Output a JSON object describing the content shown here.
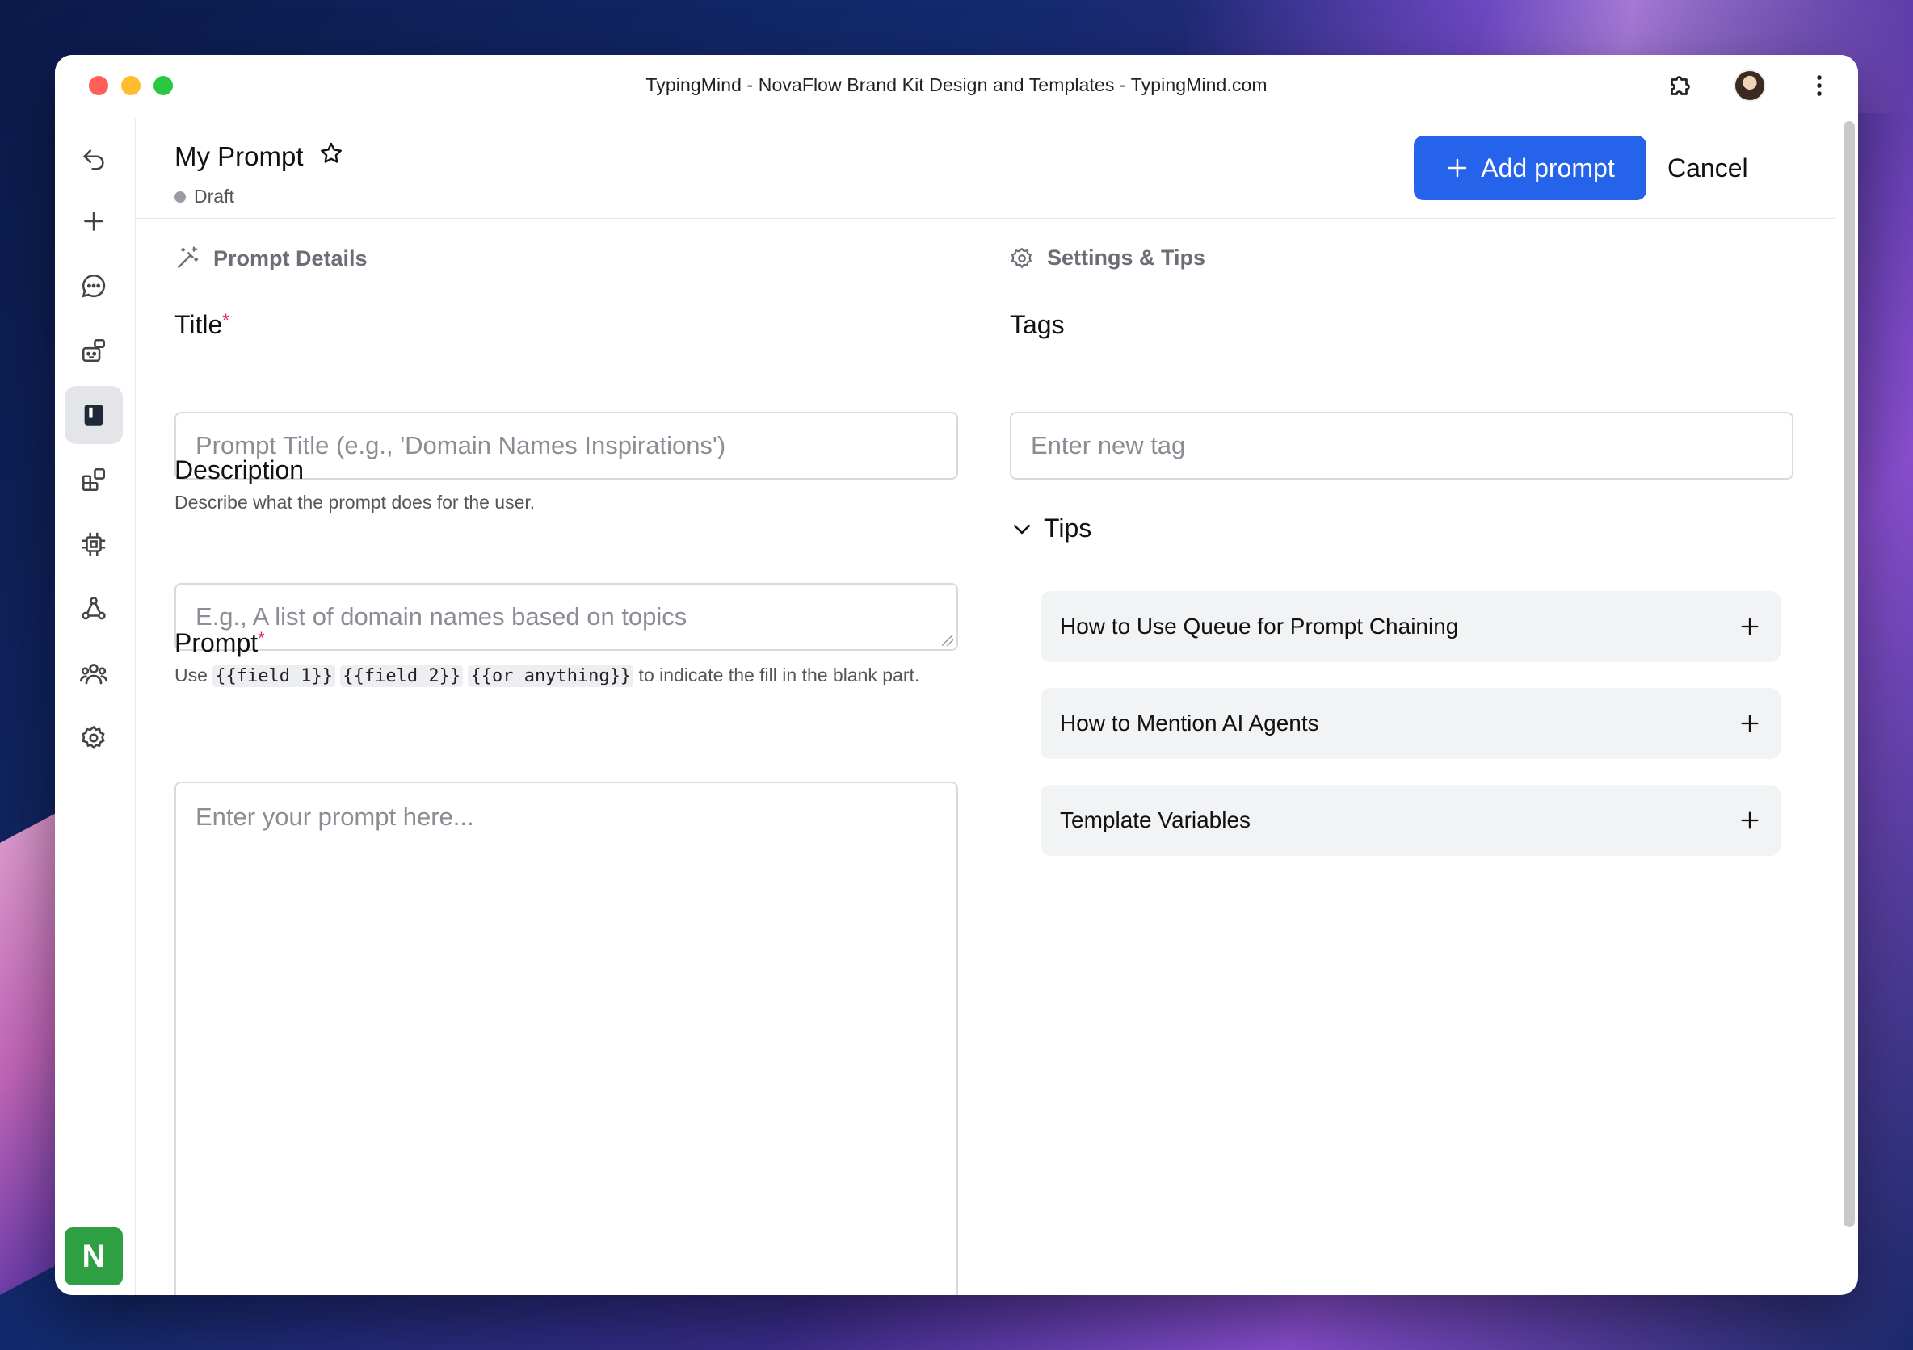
{
  "window": {
    "title": "TypingMind - NovaFlow Brand Kit Design and Templates - TypingMind.com"
  },
  "sidebar": {
    "items": [
      {
        "name": "back-icon"
      },
      {
        "name": "plus-icon"
      },
      {
        "name": "chat-icon"
      },
      {
        "name": "agents-icon"
      },
      {
        "name": "prompt-library-icon",
        "active": true
      },
      {
        "name": "plugins-icon"
      },
      {
        "name": "models-icon"
      },
      {
        "name": "knowledge-icon"
      },
      {
        "name": "team-icon"
      },
      {
        "name": "settings-icon"
      }
    ],
    "logo_letter": "N"
  },
  "header": {
    "title": "My Prompt",
    "status": "Draft",
    "add_label": "Add prompt",
    "cancel_label": "Cancel"
  },
  "details": {
    "section_title": "Prompt Details",
    "title_label": "Title",
    "title_placeholder": "Prompt Title (e.g., 'Domain Names Inspirations')",
    "description_label": "Description",
    "description_hint": "Describe what the prompt does for the user.",
    "description_placeholder": "E.g., A list of domain names based on topics",
    "prompt_label": "Prompt",
    "prompt_hint_prefix": "Use ",
    "prompt_hint_codes": [
      "{{field 1}}",
      "{{field 2}}",
      "{{or anything}}"
    ],
    "prompt_hint_suffix": " to indicate the fill in the blank part.",
    "prompt_placeholder": "Enter your prompt here...",
    "required_mark": "*"
  },
  "settings": {
    "section_title": "Settings & Tips",
    "tags_label": "Tags",
    "tags_placeholder": "Enter new tag",
    "tips_label": "Tips",
    "tips": [
      {
        "label": "How to Use Queue for Prompt Chaining"
      },
      {
        "label": "How to Mention AI Agents"
      },
      {
        "label": "Template Variables"
      }
    ]
  },
  "colors": {
    "accent": "#2563eb",
    "required": "#e11d48",
    "logo": "#2ea043"
  }
}
